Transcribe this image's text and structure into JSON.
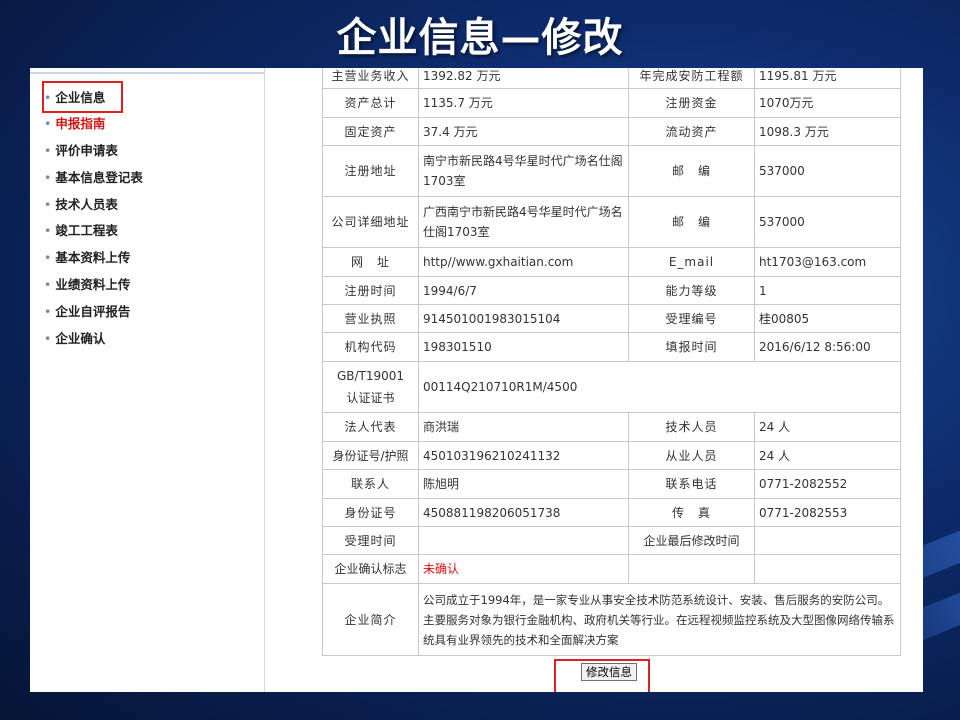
{
  "slide_title": "企业信息—修改",
  "sidebar": {
    "items": [
      {
        "label": "企业信息"
      },
      {
        "label": "申报指南"
      },
      {
        "label": "评价申请表"
      },
      {
        "label": "基本信息登记表"
      },
      {
        "label": "技术人员表"
      },
      {
        "label": "竣工工程表"
      },
      {
        "label": "基本资料上传"
      },
      {
        "label": "业绩资料上传"
      },
      {
        "label": "企业自评报告"
      },
      {
        "label": "企业确认"
      }
    ]
  },
  "form": {
    "main_revenue_label": "主营业务收入",
    "main_revenue_value": "1392.82 万元",
    "annual_security_label": "年完成安防工程额",
    "annual_security_value": "1195.81 万元",
    "total_assets_label": "资产总计",
    "total_assets_value": "1135.7 万元",
    "reg_capital_label": "注册资金",
    "reg_capital_value": "1070万元",
    "fixed_assets_label": "固定资产",
    "fixed_assets_value": "37.4 万元",
    "current_assets_label": "流动资产",
    "current_assets_value": "1098.3 万元",
    "reg_address_label": "注册地址",
    "reg_address_value": "南宁市新民路4号华星时代广场名仕阁1703室",
    "postcode_label": "邮　编",
    "postcode_value": "537000",
    "detail_address_label": "公司详细地址",
    "detail_address_value": "广西南宁市新民路4号华星时代广场名仕阁1703室",
    "postcode2_label": "邮　编",
    "postcode2_value": "537000",
    "website_label": "网　址",
    "website_value": "http//www.gxhaitian.com",
    "email_label": "E_mail",
    "email_value": "ht1703@163.com",
    "reg_time_label": "注册时间",
    "reg_time_value": "1994/6/7",
    "level_label": "能力等级",
    "level_value": "1",
    "license_label": "营业执照",
    "license_value": "914501001983015104",
    "accept_no_label": "受理编号",
    "accept_no_value": "桂00805",
    "org_code_label": "机构代码",
    "org_code_value": "198301510",
    "fill_time_label": "填报时间",
    "fill_time_value": "2016/6/12 8:56:00",
    "gb_cert_label_1": "GB/T19001",
    "gb_cert_label_2": "认证证书",
    "gb_cert_value": "00114Q210710R1M/4500",
    "legal_rep_label": "法人代表",
    "legal_rep_value": "商洪瑞",
    "tech_staff_label": "技术人员",
    "tech_staff_value": "24 人",
    "id_passport_label": "身份证号/护照",
    "id_passport_value": "450103196210241132",
    "employees_label": "从业人员",
    "employees_value": "24 人",
    "contact_label": "联系人",
    "contact_value": "陈旭明",
    "phone_label": "联系电话",
    "phone_value": "0771-2082552",
    "id_no_label": "身份证号",
    "id_no_value": "450881198206051738",
    "fax_label": "传　真",
    "fax_value": "0771-2082553",
    "accept_time_label": "受理时间",
    "accept_time_value": "",
    "last_modified_label": "企业最后修改时间",
    "last_modified_value": "",
    "confirm_label": "企业确认标志",
    "confirm_value": "未确认",
    "intro_label": "企业简介",
    "intro_value": "公司成立于1994年，是一家专业从事安全技术防范系统设计、安装、售后服务的安防公司。主要服务对象为银行金融机构、政府机关等行业。在远程视频监控系统及大型图像网络传输系统具有业界领先的技术和全面解决方案"
  },
  "submit_label": "修改信息",
  "colors": {
    "highlight_red": "#e02020",
    "unconfirmed_red": "#e01010",
    "active_menu_red": "#d01818"
  }
}
